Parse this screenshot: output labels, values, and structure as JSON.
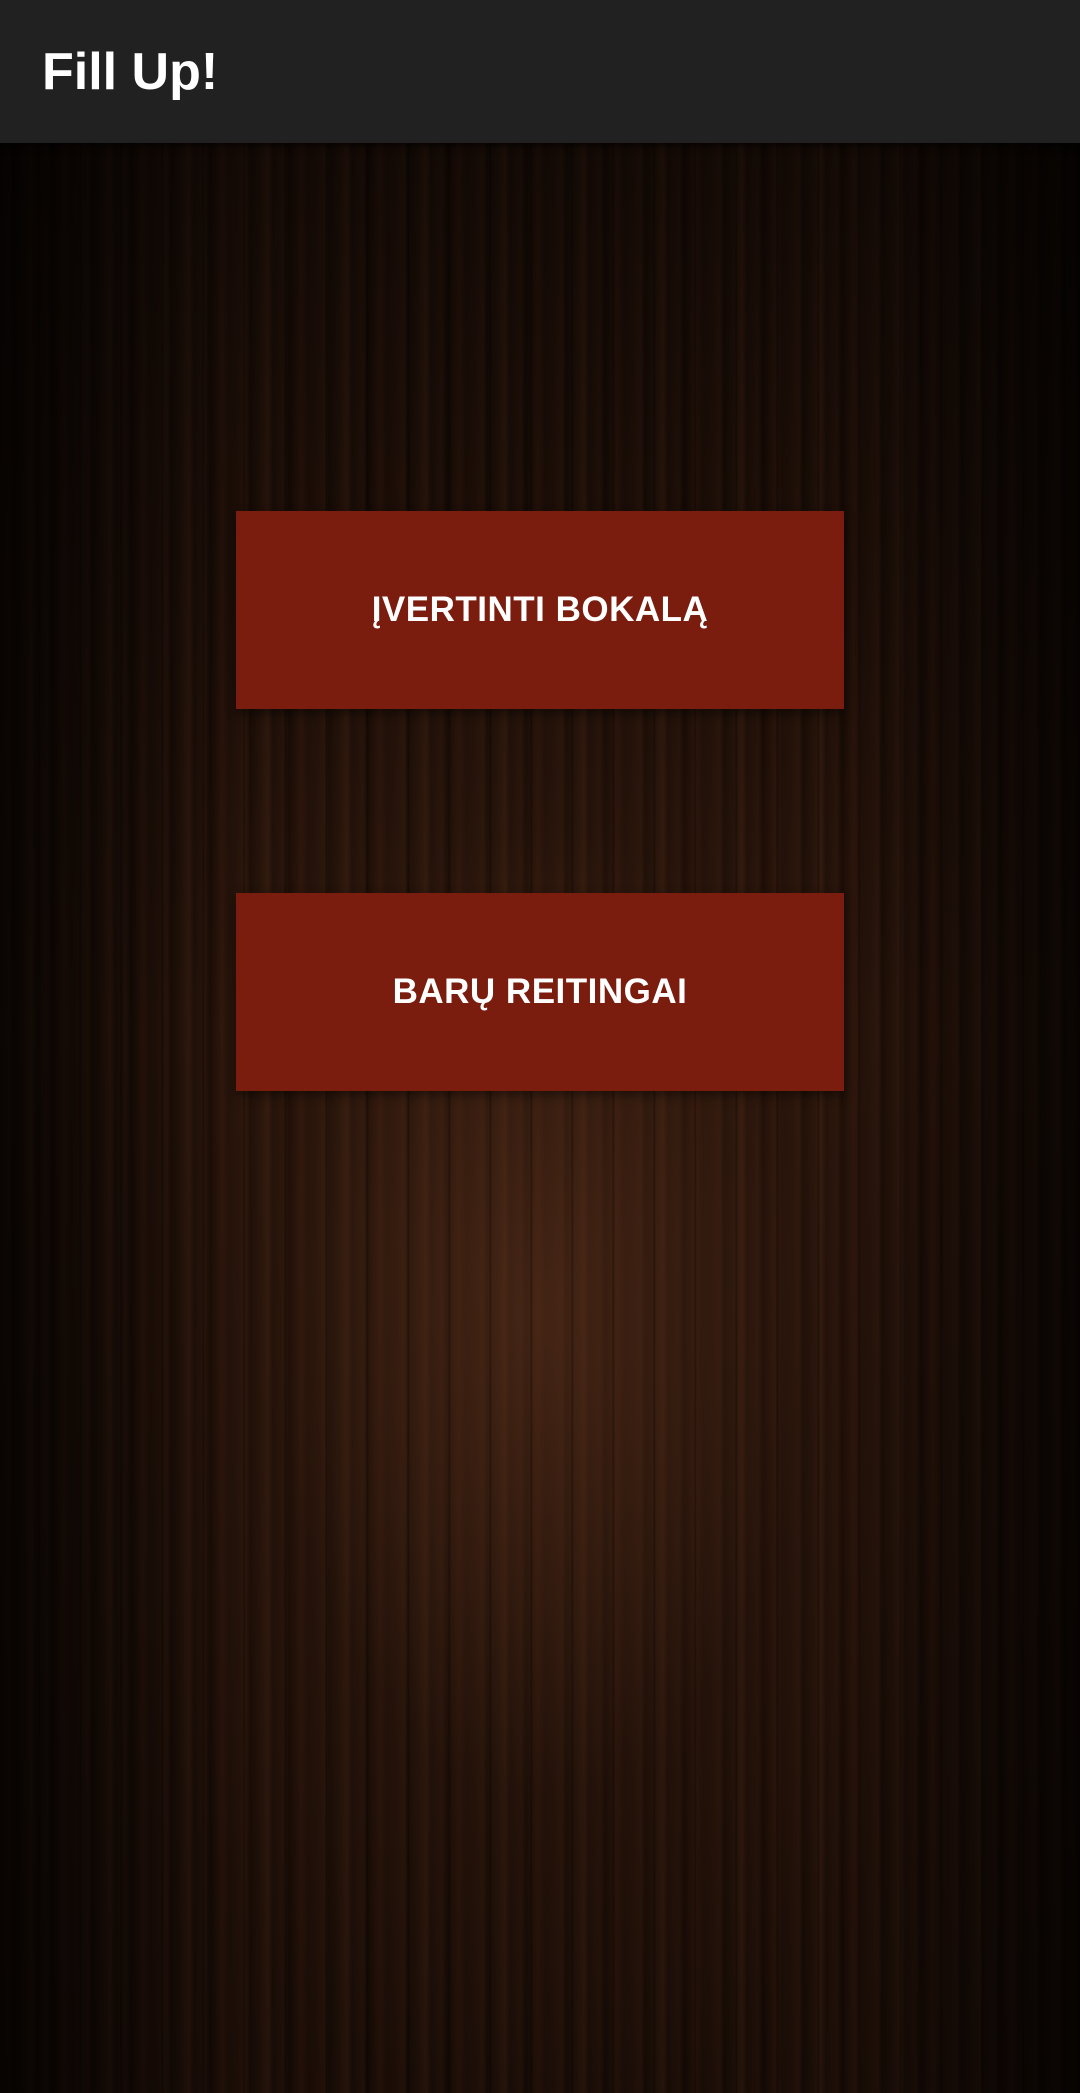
{
  "app_bar": {
    "title": "Fill Up!"
  },
  "main": {
    "rate_button_label": "ĮVERTINTI BOKALĄ",
    "ratings_button_label": "BARŲ REITINGAI"
  },
  "colors": {
    "app_bar_background": "#212121",
    "button_background": "#7a1d0f",
    "button_text": "#ffffff",
    "background": "#2a150b"
  }
}
